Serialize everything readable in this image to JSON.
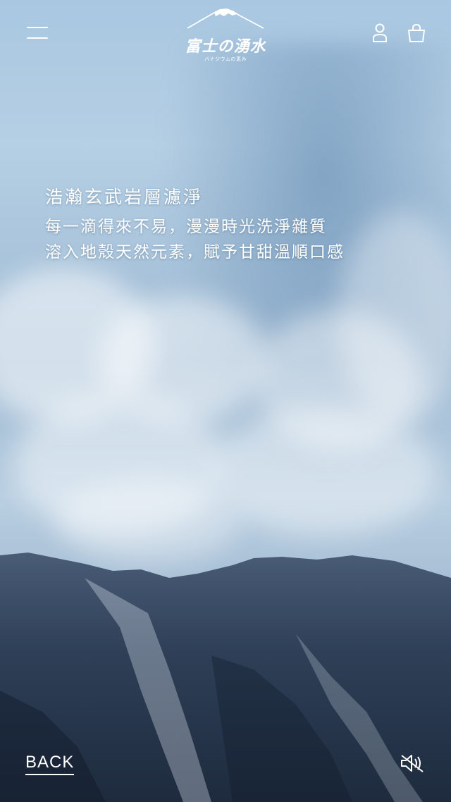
{
  "header": {
    "menu_icon": "hamburger-menu-icon",
    "logo_title": "富士の湧水",
    "logo_subtitle": "バナジウムの恵み",
    "account_icon": "user-icon",
    "cart_icon": "shopping-bag-icon"
  },
  "hero": {
    "heading": "浩瀚玄武岩層濾淨",
    "line1": "每一滴得來不易，漫漫時光洗淨雜質",
    "line2": "溶入地殼天然元素，賦予甘甜溫順口感"
  },
  "footer": {
    "back_label": "BACK",
    "sound_icon": "speaker-muted-icon"
  },
  "colors": {
    "sky": "#a9c7e1",
    "text": "#ffffff",
    "mountain": "#2c3d54"
  }
}
